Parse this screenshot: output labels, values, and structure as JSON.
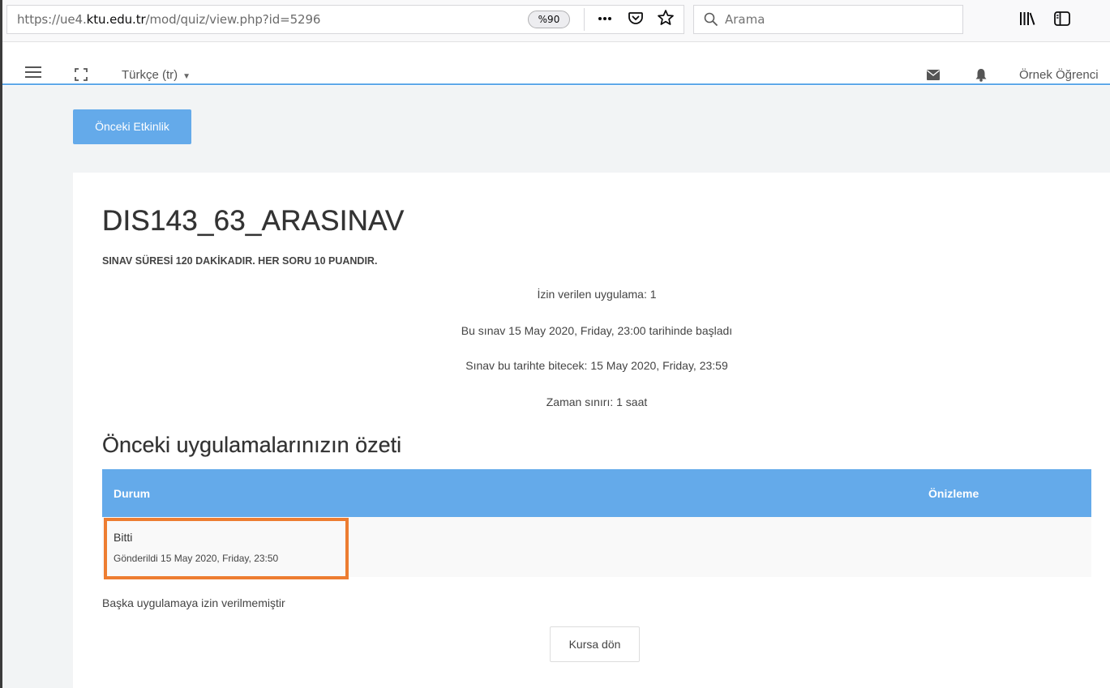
{
  "browser": {
    "url_prefix": "https://ue4.",
    "url_host": "ktu.edu.tr",
    "url_path": "/mod/quiz/view.php?id=5296",
    "zoom": "%90",
    "search_placeholder": "Arama",
    "icons": [
      "more-icon",
      "pocket-icon",
      "bookmark-star-icon",
      "search-icon",
      "library-icon",
      "sidebar-icon"
    ]
  },
  "navbar": {
    "language": "Türkçe (tr)",
    "user_name": "Örnek Öğrenci",
    "icons": [
      "hamburger-menu-icon",
      "fullscreen-icon",
      "mail-icon",
      "bell-icon"
    ]
  },
  "nav_buttons": {
    "previous_activity": "Önceki Etkinlik"
  },
  "quiz": {
    "title": "DIS143_63_ARASINAV",
    "intro": "SINAV SÜRESİ 120 DAKİKADIR. HER SORU 10 PUANDIR.",
    "info": [
      "İzin verilen uygulama: 1",
      "Bu sınav 15 May 2020, Friday, 23:00 tarihinde başladı",
      "Sınav bu tarihte bitecek: 15 May 2020, Friday, 23:59",
      "Zaman sınırı: 1 saat"
    ]
  },
  "summary": {
    "heading": "Önceki uygulamalarınızın özeti",
    "columns": [
      "Durum",
      "Önizleme"
    ],
    "rows": [
      {
        "status": "Bitti",
        "submitted": "Gönderildi 15 May 2020, Friday, 23:50"
      }
    ],
    "no_more_attempts": "Başka uygulamaya izin verilmemiştir",
    "back_button": "Kursa dön"
  },
  "colors": {
    "accent": "#64aaea",
    "highlight": "#ed7d31",
    "page_bg": "#f2f4f5"
  }
}
